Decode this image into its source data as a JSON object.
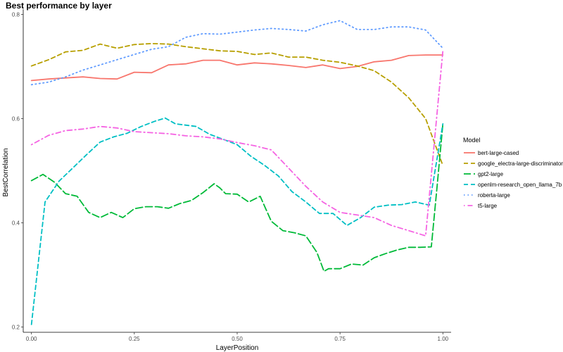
{
  "chart_data": {
    "type": "line",
    "title": "Best performance by layer",
    "xlabel": "LayerPosition",
    "ylabel": "BestCorrelation",
    "xlim": [
      -0.02,
      1.02
    ],
    "ylim": [
      0.19,
      0.81
    ],
    "x_ticks": [
      {
        "value": 0,
        "label": "0.00"
      },
      {
        "value": 0.25,
        "label": "0.25"
      },
      {
        "value": 0.5,
        "label": "0.50"
      },
      {
        "value": 0.75,
        "label": "0.75"
      },
      {
        "value": 1,
        "label": "1.00"
      }
    ],
    "y_ticks": [
      {
        "value": 0.2,
        "label": "0.2"
      },
      {
        "value": 0.4,
        "label": "0.4"
      },
      {
        "value": 0.6,
        "label": "0.6"
      },
      {
        "value": 0.8,
        "label": "0.8"
      }
    ],
    "grid": false,
    "legend_title": "Model",
    "legend_position": "right",
    "series": [
      {
        "name": "bert-large-cased",
        "color": "#F8766D",
        "dash": "solid",
        "x": [
          0,
          0.042,
          0.083,
          0.125,
          0.167,
          0.208,
          0.25,
          0.292,
          0.333,
          0.375,
          0.417,
          0.458,
          0.5,
          0.542,
          0.583,
          0.625,
          0.667,
          0.708,
          0.75,
          0.792,
          0.833,
          0.875,
          0.917,
          0.958,
          1.0
        ],
        "y": [
          0.673,
          0.676,
          0.678,
          0.68,
          0.677,
          0.676,
          0.689,
          0.688,
          0.703,
          0.705,
          0.712,
          0.712,
          0.703,
          0.707,
          0.705,
          0.702,
          0.698,
          0.703,
          0.696,
          0.7,
          0.709,
          0.712,
          0.721,
          0.722,
          0.722
        ]
      },
      {
        "name": "google_electra-large-discriminator",
        "color": "#B79F00",
        "dash": "dashed",
        "x": [
          0,
          0.042,
          0.083,
          0.125,
          0.167,
          0.208,
          0.25,
          0.292,
          0.333,
          0.375,
          0.417,
          0.458,
          0.5,
          0.542,
          0.583,
          0.625,
          0.667,
          0.708,
          0.75,
          0.792,
          0.833,
          0.875,
          0.917,
          0.958,
          1.0
        ],
        "y": [
          0.701,
          0.713,
          0.728,
          0.731,
          0.743,
          0.735,
          0.742,
          0.744,
          0.743,
          0.738,
          0.734,
          0.73,
          0.729,
          0.723,
          0.726,
          0.718,
          0.718,
          0.712,
          0.708,
          0.701,
          0.692,
          0.67,
          0.64,
          0.6,
          0.51
        ]
      },
      {
        "name": "gpt2-large",
        "color": "#00BA38",
        "dash": "longdash",
        "x": [
          0,
          0.028,
          0.056,
          0.083,
          0.111,
          0.139,
          0.167,
          0.194,
          0.222,
          0.25,
          0.278,
          0.306,
          0.333,
          0.361,
          0.389,
          0.417,
          0.444,
          0.458,
          0.472,
          0.5,
          0.528,
          0.556,
          0.583,
          0.611,
          0.639,
          0.667,
          0.694,
          0.711,
          0.722,
          0.75,
          0.778,
          0.806,
          0.833,
          0.861,
          0.889,
          0.917,
          0.944,
          0.972,
          0.986,
          1.0
        ],
        "y": [
          0.481,
          0.493,
          0.478,
          0.456,
          0.451,
          0.42,
          0.41,
          0.42,
          0.41,
          0.427,
          0.431,
          0.431,
          0.428,
          0.437,
          0.443,
          0.458,
          0.475,
          0.467,
          0.456,
          0.455,
          0.44,
          0.451,
          0.403,
          0.385,
          0.381,
          0.375,
          0.343,
          0.307,
          0.312,
          0.312,
          0.321,
          0.319,
          0.333,
          0.341,
          0.348,
          0.353,
          0.353,
          0.354,
          0.47,
          0.59
        ]
      },
      {
        "name": "openlm-research_open_llama_7b",
        "color": "#00BFC4",
        "dash": "dashed",
        "x": [
          0,
          0.033,
          0.067,
          0.1,
          0.133,
          0.167,
          0.2,
          0.233,
          0.267,
          0.3,
          0.325,
          0.35,
          0.4,
          0.433,
          0.467,
          0.5,
          0.533,
          0.567,
          0.6,
          0.633,
          0.667,
          0.7,
          0.733,
          0.767,
          0.8,
          0.833,
          0.867,
          0.9,
          0.933,
          0.967,
          1.0
        ],
        "y": [
          0.205,
          0.44,
          0.48,
          0.505,
          0.53,
          0.555,
          0.565,
          0.572,
          0.585,
          0.595,
          0.601,
          0.59,
          0.585,
          0.57,
          0.56,
          0.55,
          0.528,
          0.51,
          0.49,
          0.46,
          0.44,
          0.418,
          0.418,
          0.395,
          0.41,
          0.43,
          0.434,
          0.435,
          0.44,
          0.434,
          0.59
        ]
      },
      {
        "name": "roberta-large",
        "color": "#619CFF",
        "dash": "dotted",
        "x": [
          0,
          0.042,
          0.083,
          0.125,
          0.167,
          0.208,
          0.25,
          0.292,
          0.333,
          0.375,
          0.417,
          0.458,
          0.5,
          0.542,
          0.583,
          0.625,
          0.667,
          0.708,
          0.75,
          0.792,
          0.833,
          0.875,
          0.917,
          0.958,
          1.0
        ],
        "y": [
          0.665,
          0.67,
          0.68,
          0.693,
          0.703,
          0.713,
          0.723,
          0.733,
          0.738,
          0.756,
          0.763,
          0.762,
          0.766,
          0.77,
          0.773,
          0.771,
          0.768,
          0.78,
          0.788,
          0.771,
          0.771,
          0.776,
          0.776,
          0.77,
          0.735
        ]
      },
      {
        "name": "t5-large",
        "color": "#F564E3",
        "dash": "dotdash",
        "x": [
          0,
          0.042,
          0.083,
          0.125,
          0.167,
          0.208,
          0.25,
          0.292,
          0.333,
          0.375,
          0.417,
          0.458,
          0.5,
          0.542,
          0.583,
          0.625,
          0.667,
          0.708,
          0.75,
          0.792,
          0.833,
          0.875,
          0.917,
          0.958,
          1.0
        ],
        "y": [
          0.55,
          0.568,
          0.577,
          0.58,
          0.585,
          0.582,
          0.575,
          0.573,
          0.571,
          0.567,
          0.565,
          0.561,
          0.554,
          0.548,
          0.54,
          0.505,
          0.47,
          0.44,
          0.42,
          0.415,
          0.41,
          0.395,
          0.385,
          0.375,
          0.73
        ]
      }
    ]
  }
}
